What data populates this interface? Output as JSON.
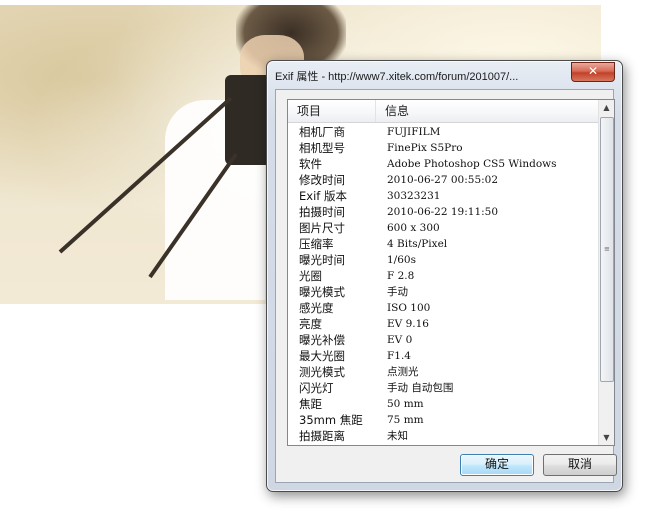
{
  "window": {
    "title": "Exif 属性 - http://www7.xitek.com/forum/201007/...",
    "close_symbol": "✕"
  },
  "list": {
    "headers": [
      "项目",
      "信息"
    ],
    "rows": [
      {
        "key": "相机厂商",
        "value": "FUJIFILM"
      },
      {
        "key": "相机型号",
        "value": "FinePix S5Pro"
      },
      {
        "key": "软件",
        "value": "Adobe Photoshop CS5 Windows"
      },
      {
        "key": "修改时间",
        "value": "2010-06-27 00:55:02"
      },
      {
        "key": "Exif 版本",
        "value": "30323231"
      },
      {
        "key": "拍摄时间",
        "value": "2010-06-22 19:11:50"
      },
      {
        "key": "图片尺寸",
        "value": "600 x 300"
      },
      {
        "key": "压缩率",
        "value": "4 Bits/Pixel"
      },
      {
        "key": "曝光时间",
        "value": "1/60s"
      },
      {
        "key": "光圈",
        "value": "F 2.8"
      },
      {
        "key": "曝光模式",
        "value": "手动"
      },
      {
        "key": "感光度",
        "value": "ISO 100"
      },
      {
        "key": "亮度",
        "value": "EV 9.16"
      },
      {
        "key": "曝光补偿",
        "value": "EV 0"
      },
      {
        "key": "最大光圈",
        "value": "F1.4"
      },
      {
        "key": "测光模式",
        "value": "点测光"
      },
      {
        "key": "闪光灯",
        "value": "手动 自动包围"
      },
      {
        "key": "焦距",
        "value": "50 mm"
      },
      {
        "key": "35mm 焦距",
        "value": "75 mm"
      },
      {
        "key": "拍摄距离",
        "value": "未知"
      }
    ]
  },
  "scrollbar": {
    "up_arrow": "▲",
    "down_arrow": "▼",
    "grip": "≡"
  },
  "buttons": {
    "ok_label": "确定",
    "cancel_label": "取消"
  }
}
